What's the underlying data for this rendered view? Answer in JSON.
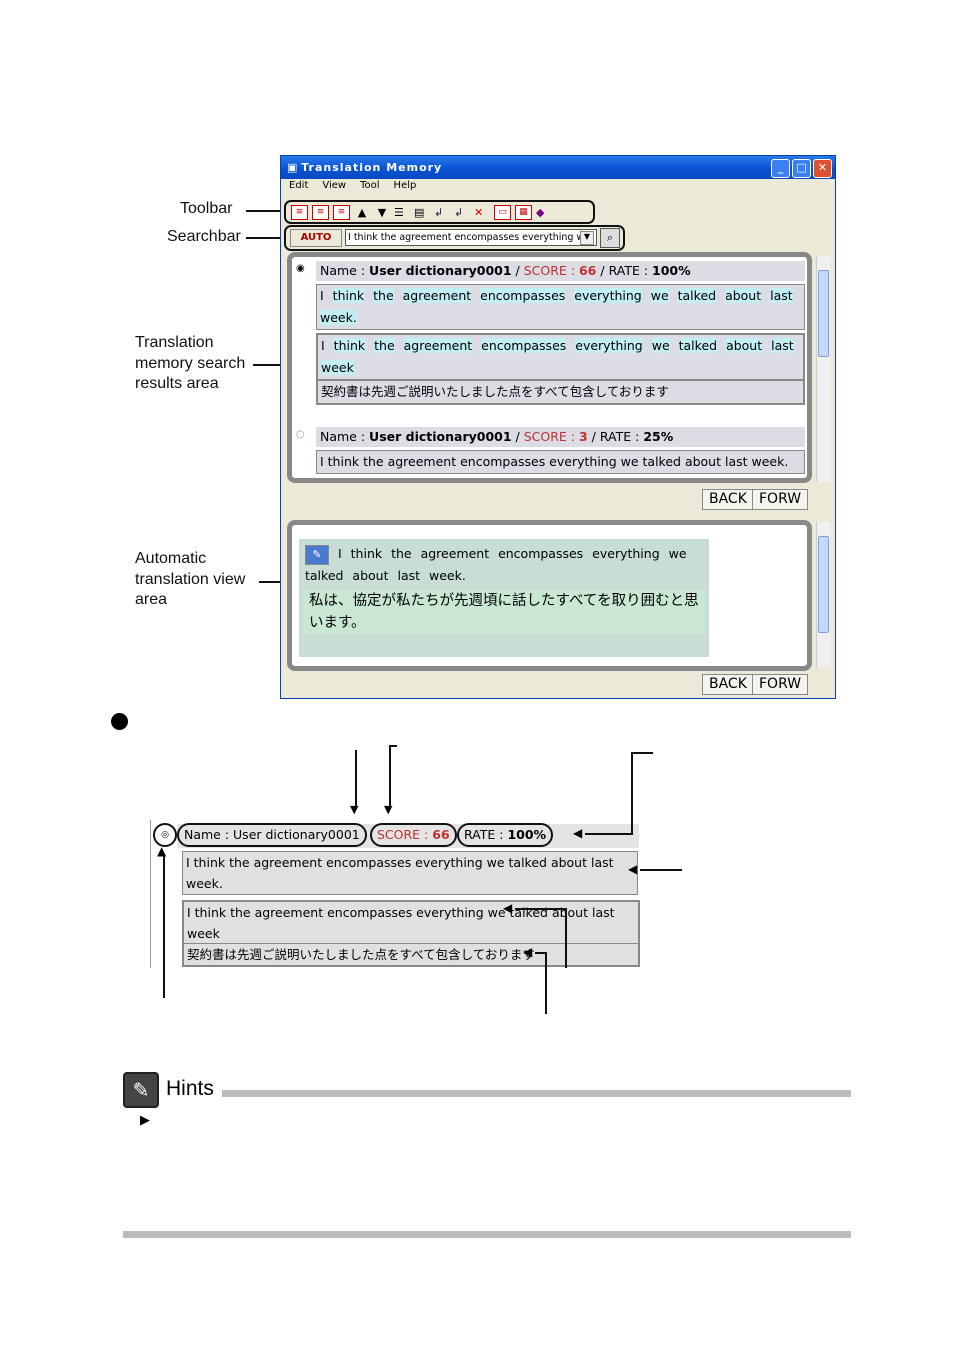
{
  "callouts": {
    "toolbar": "Toolbar",
    "searchbar": "Searchbar",
    "results": "Translation memory search results area",
    "auto": "Automatic translation view area"
  },
  "window": {
    "title": "Translation Memory",
    "menu": [
      "Edit",
      "View",
      "Tool",
      "Help"
    ],
    "search": {
      "auto_label": "AUTO",
      "value": "I think the agreement encompasses everything w"
    },
    "results": [
      {
        "name_label": "Name : ",
        "name": "User dictionary0001",
        "score_label": "SCORE : ",
        "score": "66",
        "rate_label": "RATE : ",
        "rate": "100%",
        "source": [
          "I",
          "think",
          "the",
          "agreement",
          "encompasses",
          "everything",
          "we",
          "talked",
          "about",
          "last",
          "week."
        ],
        "match": [
          "I",
          "think",
          "the",
          "agreement",
          "encompasses",
          "everything",
          "we",
          "talked",
          "about",
          "last",
          "week"
        ],
        "target": "契約書は先週ご説明いたしました点をすべて包含しております"
      },
      {
        "name_label": "Name : ",
        "name": "User dictionary0001",
        "score_label": "SCORE : ",
        "score": "3",
        "rate_label": "RATE : ",
        "rate": "25%",
        "source_text": "I think the agreement encompasses everything we talked about last week."
      }
    ],
    "back": "BACK",
    "forw": "FORW",
    "auto_view": {
      "source": "I think the agreement encompasses everything we talked about last week.",
      "target": "私は、協定が私たちが先週頃に話したすべてを取り囲むと思います。"
    }
  },
  "detail": {
    "name": "Name : User dictionary0001",
    "score_label": "SCORE : ",
    "score": "66",
    "rate_label": "RATE : ",
    "rate": "100%",
    "source": "I think the agreement encompasses everything we talked about last week.",
    "match": "I think the agreement encompasses everything we talked about last week",
    "target": "契約書は先週ご説明いたしました点をすべて包含しております"
  },
  "hints": {
    "title": "Hints"
  }
}
